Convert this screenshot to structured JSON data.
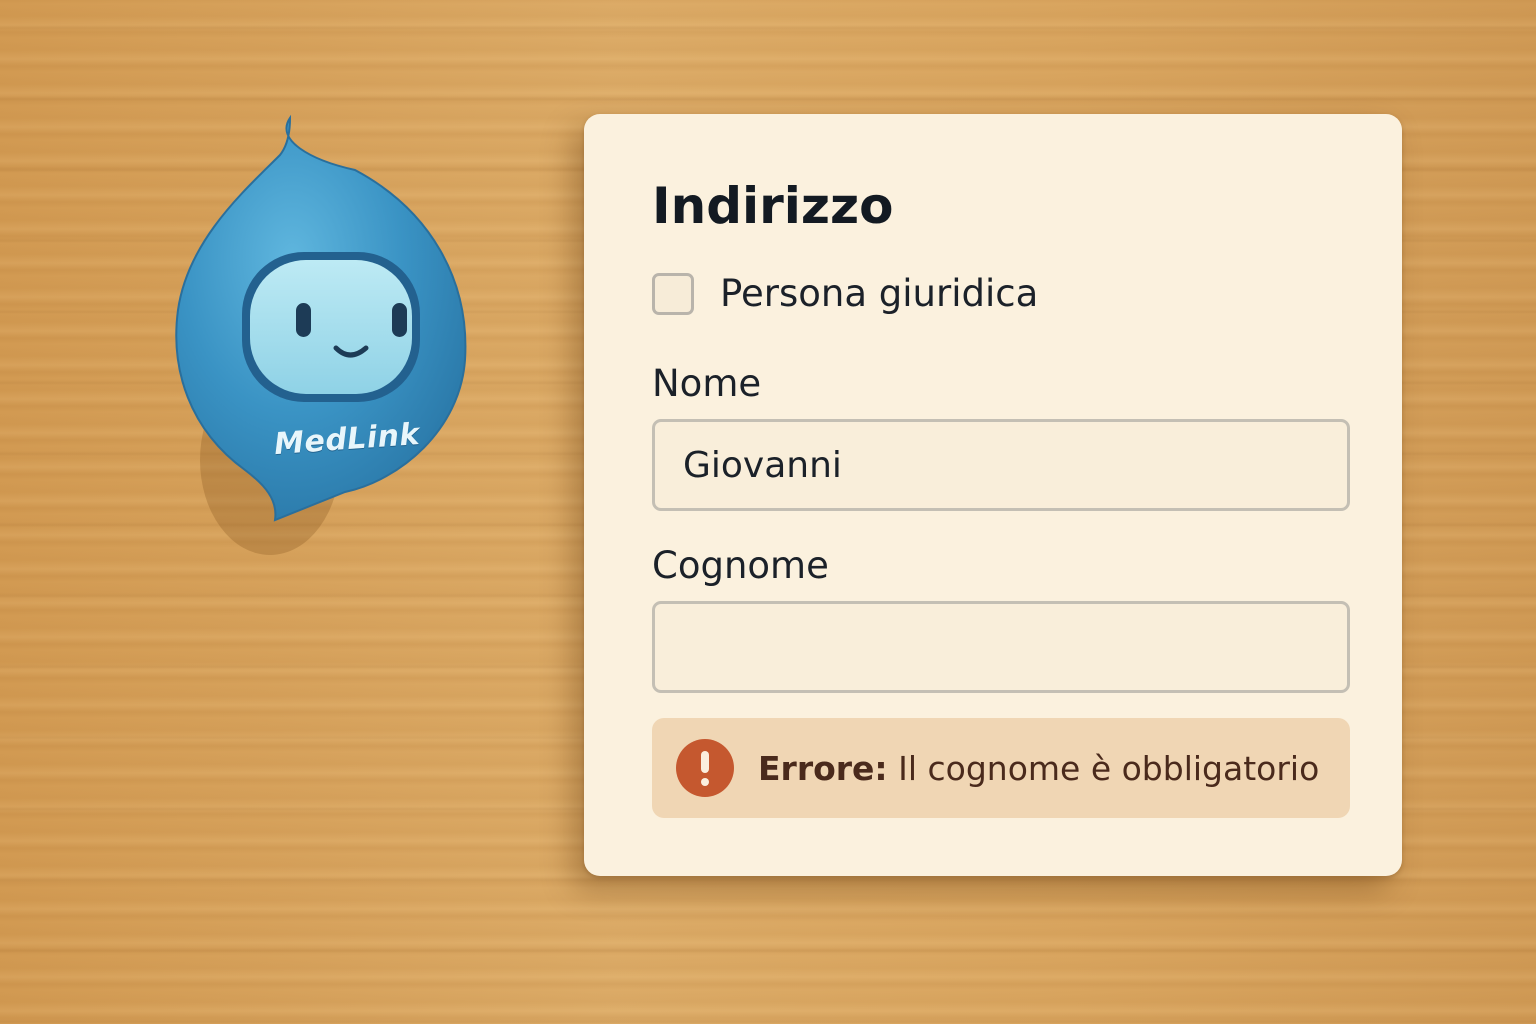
{
  "mascot": {
    "brand": "MedLink",
    "color": "#3a93c4"
  },
  "form": {
    "title": "Indirizzo",
    "checkbox": {
      "label": "Persona giuridica",
      "checked": false
    },
    "fields": {
      "nome": {
        "label": "Nome",
        "value": "Giovanni"
      },
      "cognome": {
        "label": "Cognome",
        "value": ""
      }
    },
    "error": {
      "prefix": "Errore:",
      "message": " Il cognome è obbligatorio",
      "icon": "exclamation-icon",
      "color": "#c5582f"
    }
  },
  "colors": {
    "card": "#fbf1de",
    "error_background": "#f0d6b4",
    "wood": "#d9a55e"
  }
}
